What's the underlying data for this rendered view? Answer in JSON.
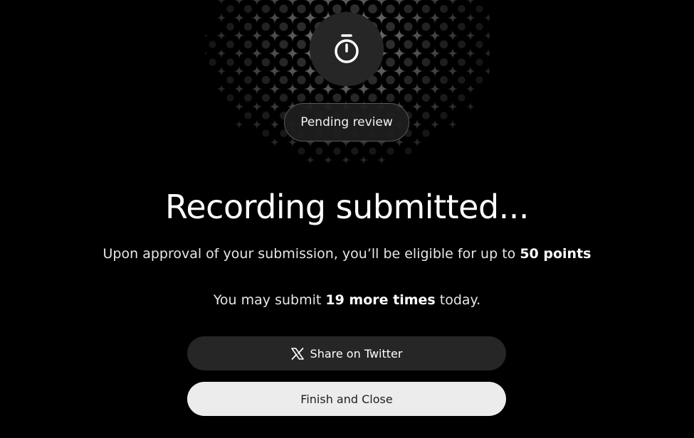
{
  "status": {
    "icon": "stopwatch-icon",
    "badge_label": "Pending review"
  },
  "main": {
    "title": "Recording submitted...",
    "approval_text_prefix": "Upon approval of your submission, you’ll be eligible for up to ",
    "approval_points": "50 points",
    "remaining_prefix": "You may submit ",
    "remaining_count": "19 more times",
    "remaining_suffix": " today."
  },
  "actions": {
    "share_icon": "x-logo-icon",
    "share_label": "Share on Twitter",
    "finish_label": "Finish and Close"
  },
  "colors": {
    "background": "#000000",
    "circle": "#262626",
    "share_button": "#262626",
    "finish_button": "#ececec"
  }
}
